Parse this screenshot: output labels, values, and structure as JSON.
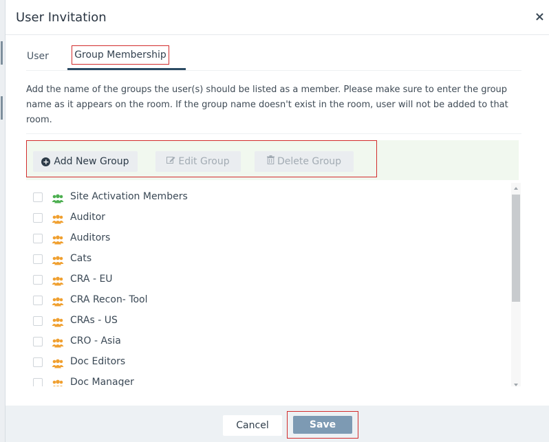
{
  "dialog": {
    "title": "User Invitation",
    "close_label": "×"
  },
  "tabs": [
    {
      "label": "User",
      "active": false
    },
    {
      "label": "Group Membership",
      "active": true
    }
  ],
  "description": "Add the name of the groups the user(s) should be listed as a member. Please make sure to enter the group name as it appears on the room. If the group name doesn't exist in the room, user will not be added to that room.",
  "toolbar": {
    "add_label": "Add New Group",
    "edit_label": "Edit Group",
    "delete_label": "Delete Group",
    "edit_enabled": false,
    "delete_enabled": false
  },
  "groups": [
    {
      "name": "Site Activation Members",
      "icon_color": "#4caf50",
      "checked": false
    },
    {
      "name": "Auditor",
      "icon_color": "#f0a030",
      "checked": false
    },
    {
      "name": "Auditors",
      "icon_color": "#f0a030",
      "checked": false
    },
    {
      "name": "Cats",
      "icon_color": "#f0a030",
      "checked": false
    },
    {
      "name": "CRA - EU",
      "icon_color": "#f0a030",
      "checked": false
    },
    {
      "name": "CRA Recon- Tool",
      "icon_color": "#f0a030",
      "checked": false
    },
    {
      "name": "CRAs - US",
      "icon_color": "#f0a030",
      "checked": false
    },
    {
      "name": "CRO - Asia",
      "icon_color": "#f0a030",
      "checked": false
    },
    {
      "name": "Doc Editors",
      "icon_color": "#f0a030",
      "checked": false
    },
    {
      "name": "Doc Manager",
      "icon_color": "#f0a030",
      "checked": false
    }
  ],
  "footer": {
    "cancel_label": "Cancel",
    "save_label": "Save"
  },
  "colors": {
    "accent": "#2b4a63",
    "highlight_outline": "#d22b2b",
    "save_button": "#7d9ab3",
    "toolbar_bg": "#f1f8ef"
  }
}
